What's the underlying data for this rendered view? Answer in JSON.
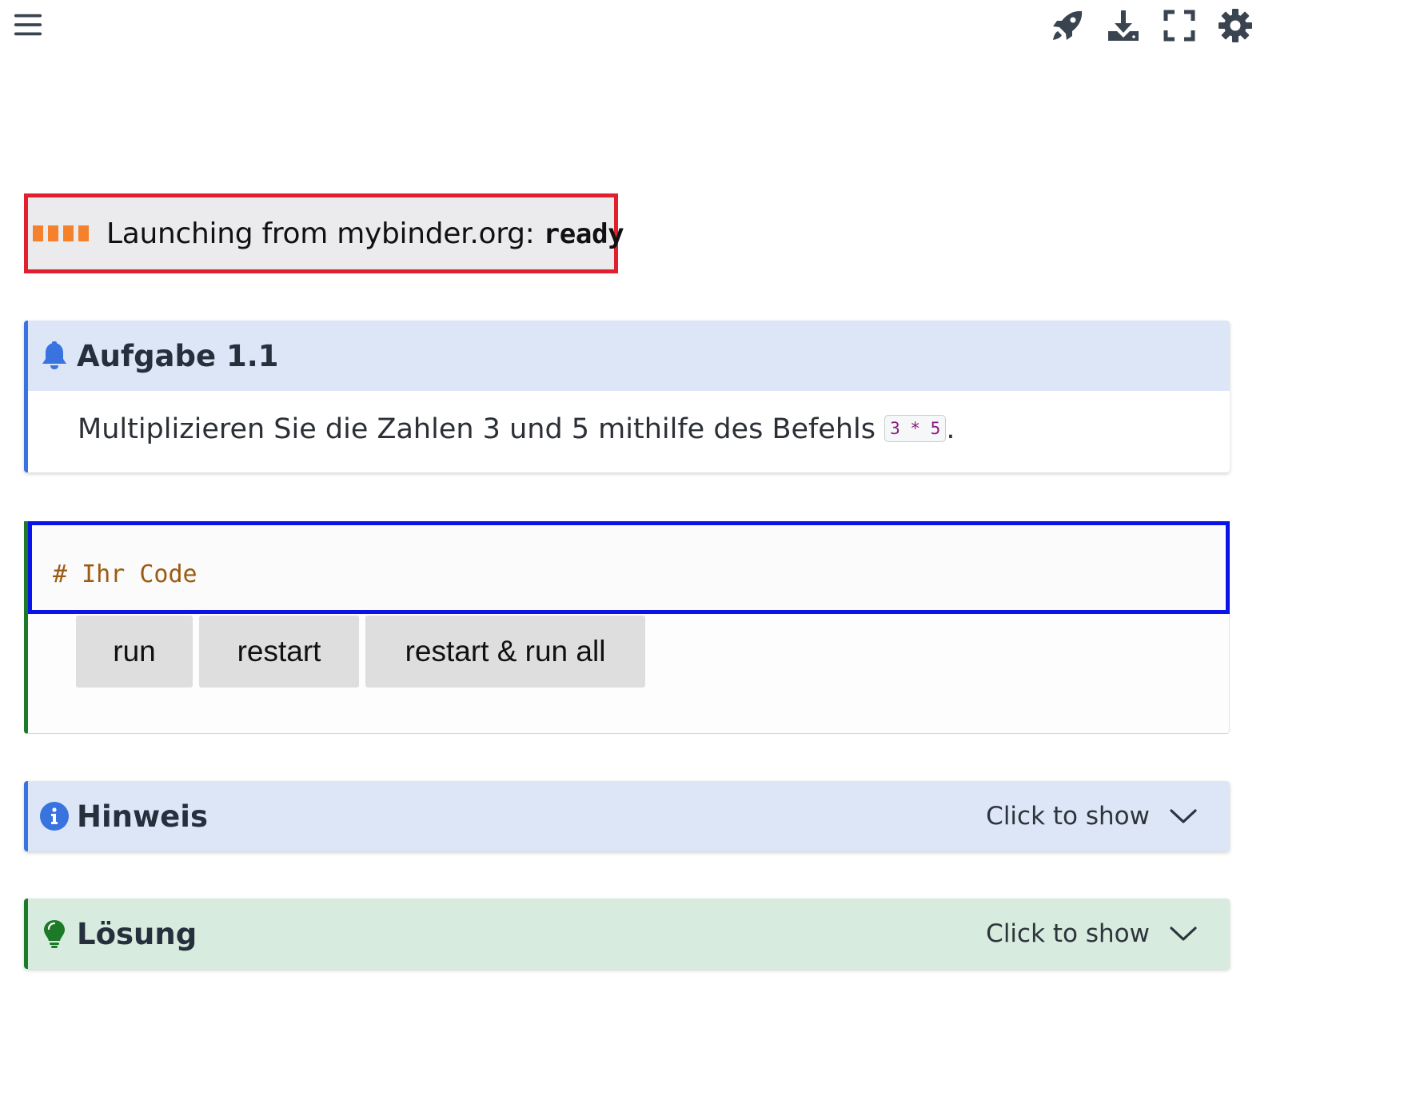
{
  "topbar": {
    "menu_icon": "hamburger-menu-icon",
    "tools": [
      {
        "name": "launch",
        "icon": "rocket-icon"
      },
      {
        "name": "download",
        "icon": "download-icon"
      },
      {
        "name": "fullscreen",
        "icon": "fullscreen-icon"
      },
      {
        "name": "settings",
        "icon": "gear-icon"
      }
    ]
  },
  "status": {
    "label": "Launching from mybinder.org: ",
    "state": "ready",
    "bar_color": "#f5812c",
    "border_color": "#e0202f"
  },
  "task": {
    "icon": "bell-icon",
    "title": "Aufgabe 1.1",
    "text_before": "Multiplizieren Sie die Zahlen 3 und 5 mithilfe des Befehls ",
    "code": "3 * 5",
    "text_after": "."
  },
  "code_cell": {
    "code": "# Ihr Code",
    "buttons": {
      "run": "run",
      "restart": "restart",
      "run_all": "restart & run all"
    }
  },
  "hint": {
    "icon": "info-icon",
    "title": "Hinweis",
    "toggle": "Click to show"
  },
  "solution": {
    "icon": "lightbulb-icon",
    "title": "Lösung",
    "toggle": "Click to show"
  },
  "colors": {
    "accent_blue": "#3873e0",
    "accent_green": "#1d7a29",
    "editor_border": "#0a14e8"
  }
}
